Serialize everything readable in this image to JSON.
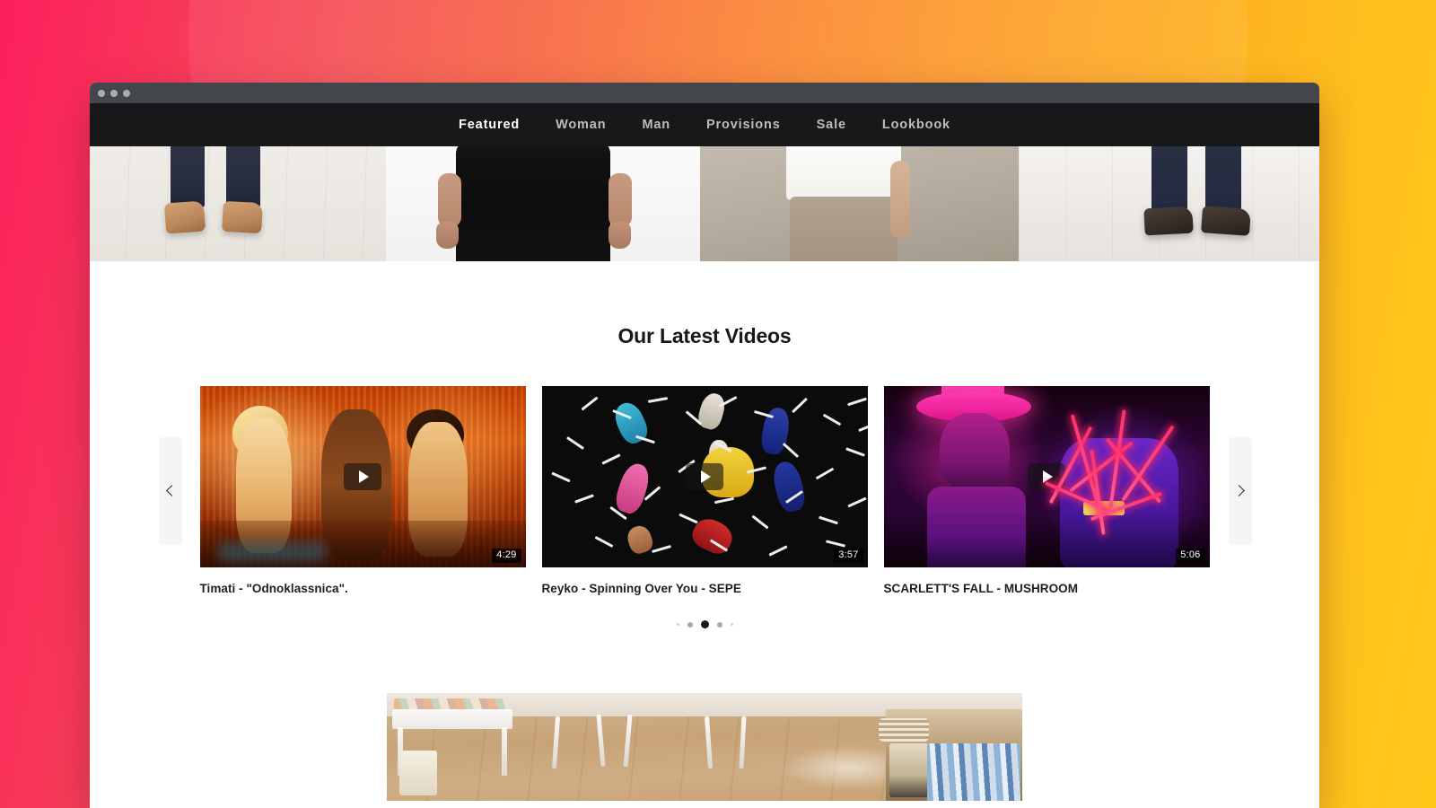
{
  "background": {
    "gradient_start": "#fc1f5c",
    "gradient_mid": "#fb8434",
    "gradient_end": "#ffc91a"
  },
  "browser": {
    "dots": [
      "window-dot-close",
      "window-dot-minimize",
      "window-dot-zoom"
    ]
  },
  "nav": {
    "items": [
      {
        "label": "Featured",
        "active": true
      },
      {
        "label": "Woman",
        "active": false
      },
      {
        "label": "Man",
        "active": false
      },
      {
        "label": "Provisions",
        "active": false
      },
      {
        "label": "Sale",
        "active": false
      },
      {
        "label": "Lookbook",
        "active": false
      }
    ]
  },
  "hero": {
    "tiles": [
      {
        "name": "hero-tile-sandals"
      },
      {
        "name": "hero-tile-man-black-trousers"
      },
      {
        "name": "hero-tile-woman-taupe-trousers"
      },
      {
        "name": "hero-tile-dark-brogues"
      }
    ]
  },
  "videos": {
    "title": "Our Latest Videos",
    "prev_arrow": "‹",
    "next_arrow": "›",
    "items": [
      {
        "caption": "Timati - \"Odnoklassnica\".",
        "duration": "4:29",
        "thumb": "club-scene-orange"
      },
      {
        "caption": "Reyko - Spinning Over You - SEPE",
        "duration": "3:57",
        "thumb": "dancers-on-black"
      },
      {
        "caption": "SCARLETT'S FALL - MUSHROOM",
        "duration": "5:06",
        "thumb": "neon-magenta-portrait"
      }
    ],
    "dots": [
      {
        "size": "tiny",
        "active": false
      },
      {
        "size": "small",
        "active": false
      },
      {
        "size": "active",
        "active": true
      },
      {
        "size": "small",
        "active": false
      },
      {
        "size": "tiny",
        "active": false
      }
    ]
  },
  "store": {
    "photo_name": "boutique-interior-wood-floor"
  }
}
